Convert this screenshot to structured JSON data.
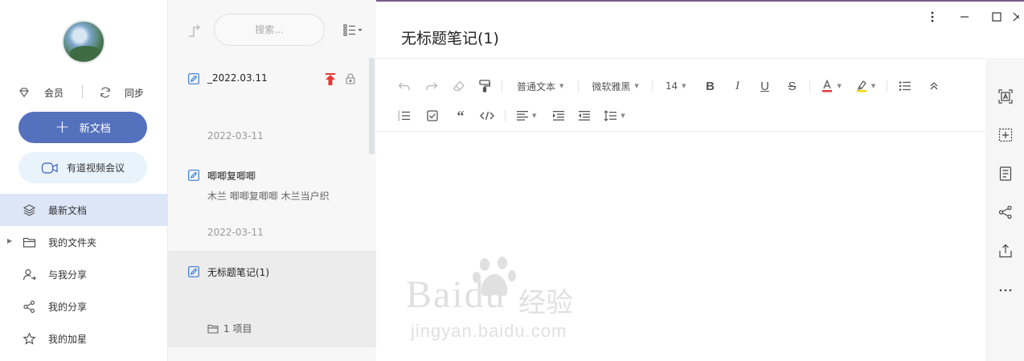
{
  "sidebar": {
    "vip_label": "会员",
    "sync_label": "同步",
    "new_doc_label": "新文档",
    "meeting_label": "有道视频会议",
    "nav": [
      {
        "label": "最新文档",
        "icon": "layers-icon",
        "active": true
      },
      {
        "label": "我的文件夹",
        "icon": "folder-icon",
        "active": false
      },
      {
        "label": "与我分享",
        "icon": "users-share-icon",
        "active": false
      },
      {
        "label": "我的分享",
        "icon": "share-icon",
        "active": false
      },
      {
        "label": "我的加星",
        "icon": "star-icon",
        "active": false
      }
    ]
  },
  "notelist": {
    "search_placeholder": "搜索...",
    "notes": [
      {
        "title": "_2022.03.11",
        "snippet": "",
        "date": "2022-03-11",
        "pinned": true,
        "locked": true
      },
      {
        "title": "唧唧复唧唧",
        "snippet": "木兰 唧唧复唧唧 木兰当户织",
        "date": "2022-03-11",
        "pinned": false,
        "locked": false
      },
      {
        "title": "无标题笔记(1)",
        "snippet": "",
        "folder_count": "1 项目",
        "selected": true
      }
    ]
  },
  "editor": {
    "title": "无标题笔记(1)",
    "toolbar": {
      "paragraph_style": "普通文本",
      "font_family": "微软雅黑",
      "font_size": "14"
    },
    "accent_color": "#5471be",
    "text_color_swatch": "#e53935",
    "highlight_color_swatch": "#f5d90a"
  },
  "watermark": {
    "brand": "Baidu",
    "brand_cn": "经验",
    "url": "jingyan.baidu.com"
  }
}
